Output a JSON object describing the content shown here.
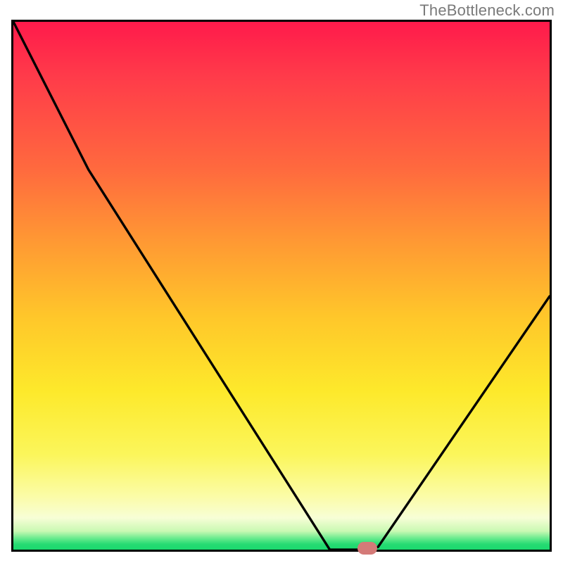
{
  "watermark": {
    "text": "TheBottleneck.com"
  },
  "colors": {
    "frame_border": "#000000",
    "marker": "#d47a78",
    "gradient_top": "#ff1a4b",
    "gradient_bottom": "#1bd96e"
  },
  "chart_data": {
    "type": "line",
    "title": "",
    "xlabel": "",
    "ylabel": "",
    "xlim": [
      0,
      100
    ],
    "ylim": [
      0,
      100
    ],
    "x": [
      0,
      14,
      59,
      66,
      68,
      100
    ],
    "values": [
      100,
      72,
      0,
      0,
      0.5,
      48
    ],
    "marker": {
      "x": 66,
      "y": 0
    },
    "annotations": []
  }
}
